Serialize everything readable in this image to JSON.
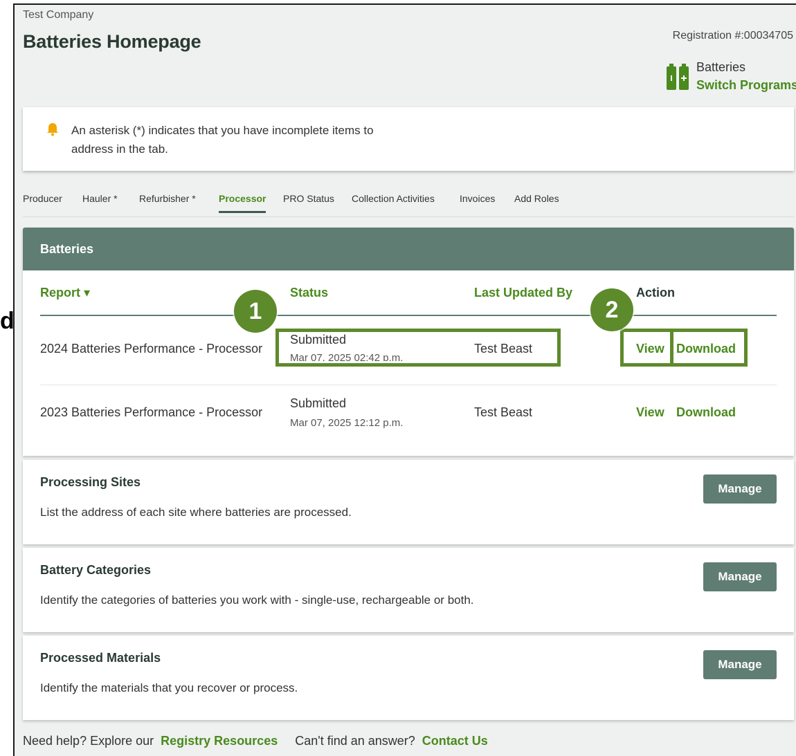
{
  "stray_text": "d",
  "header": {
    "company": "Test Company",
    "title": "Batteries Homepage",
    "registration": "Registration #:00034705",
    "program_name": "Batteries",
    "switch_label": "Switch Programs"
  },
  "notice": {
    "text": "An asterisk (*) indicates that you have incomplete items to address in the tab."
  },
  "tabs": [
    {
      "label": "Producer"
    },
    {
      "label": "Hauler *"
    },
    {
      "label": "Refurbisher *"
    },
    {
      "label": "Processor",
      "active": true
    },
    {
      "label": "PRO Status"
    },
    {
      "label": "Collection Activities"
    },
    {
      "label": "Invoices"
    },
    {
      "label": "Add Roles"
    }
  ],
  "batteries": {
    "heading": "Batteries",
    "columns": {
      "report": "Report ▾",
      "status": "Status",
      "updated_by": "Last Updated By",
      "action": "Action"
    },
    "rows": [
      {
        "report": "2024 Batteries Performance - Processor",
        "status": "Submitted",
        "date": "Mar 07, 2025 02:42 p.m.",
        "updated_by": "Test Beast",
        "view": "View",
        "download": "Download"
      },
      {
        "report": "2023 Batteries Performance - Processor",
        "status": "Submitted",
        "date": "Mar 07, 2025 12:12 p.m.",
        "updated_by": "Test Beast",
        "view": "View",
        "download": "Download"
      }
    ]
  },
  "sections": [
    {
      "title": "Processing Sites",
      "description": "List the address of each site where batteries are processed.",
      "button": "Manage"
    },
    {
      "title": "Battery Categories",
      "description": "Identify the categories of batteries you work with - single-use, rechargeable or both.",
      "button": "Manage"
    },
    {
      "title": "Processed Materials",
      "description": "Identify the materials that you recover or process.",
      "button": "Manage"
    }
  ],
  "footer": {
    "help_prefix": "Need help? Explore our",
    "help_link": "Registry Resources",
    "contact_prefix": "Can't find an answer?",
    "contact_link": "Contact Us"
  },
  "annotations": {
    "badge_1": "1",
    "badge_2": "2"
  },
  "colors": {
    "accent_green": "#4a8a1e",
    "header_bar": "#5f7d72",
    "annotation_green": "#5d8a2b"
  }
}
